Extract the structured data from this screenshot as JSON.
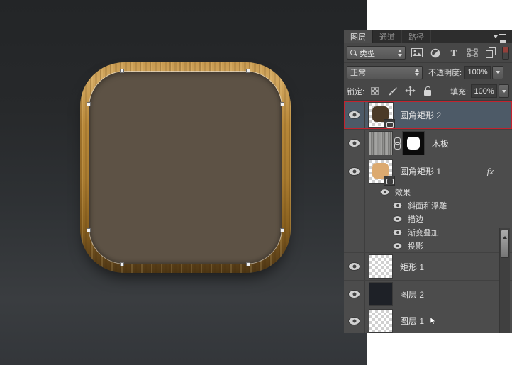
{
  "panel": {
    "tabs": [
      {
        "label": "图层",
        "active": true
      },
      {
        "label": "通道",
        "active": false
      },
      {
        "label": "路径",
        "active": false
      }
    ],
    "filter_bar": {
      "kind_label": "类型"
    },
    "blend_bar": {
      "mode": "正常",
      "opacity_label": "不透明度:",
      "opacity_value": "100%"
    },
    "lock_bar": {
      "label": "锁定:",
      "fill_label": "填充:",
      "fill_value": "100%"
    },
    "layers": [
      {
        "name": "圆角矩形 2",
        "selected": true,
        "thumb": "dark-rounded-rect-shape"
      },
      {
        "name": "木板",
        "thumb": "wood-texture",
        "has_mask": true
      },
      {
        "name": "圆角矩形 1",
        "thumb": "tan-rounded-rect-shape",
        "fx_label": "fx"
      },
      {
        "name": "矩形 1",
        "thumb": "transparent"
      },
      {
        "name": "图层 2",
        "thumb": "solid-dark"
      },
      {
        "name": "图层 1",
        "thumb": "transparent"
      }
    ],
    "effects": {
      "header": "效果",
      "items": [
        {
          "name": "斜面和浮雕"
        },
        {
          "name": "描边"
        },
        {
          "name": "渐变叠加"
        },
        {
          "name": "投影"
        }
      ]
    }
  },
  "canvas": {
    "artwork": "wood-framed rounded-square icon with vector path anchors",
    "colors": {
      "canvas_top": "#232527",
      "canvas_bottom": "#3a3d40",
      "wood_light": "#d2a75f",
      "wood_dark": "#4d3614",
      "icon_fill": "#5d5245"
    }
  },
  "colors": {
    "selection_blue": "#4d5a67",
    "annotation_red": "#c2232e",
    "panel_bg": "#4c4c4c",
    "text": "#e2e2e2"
  }
}
